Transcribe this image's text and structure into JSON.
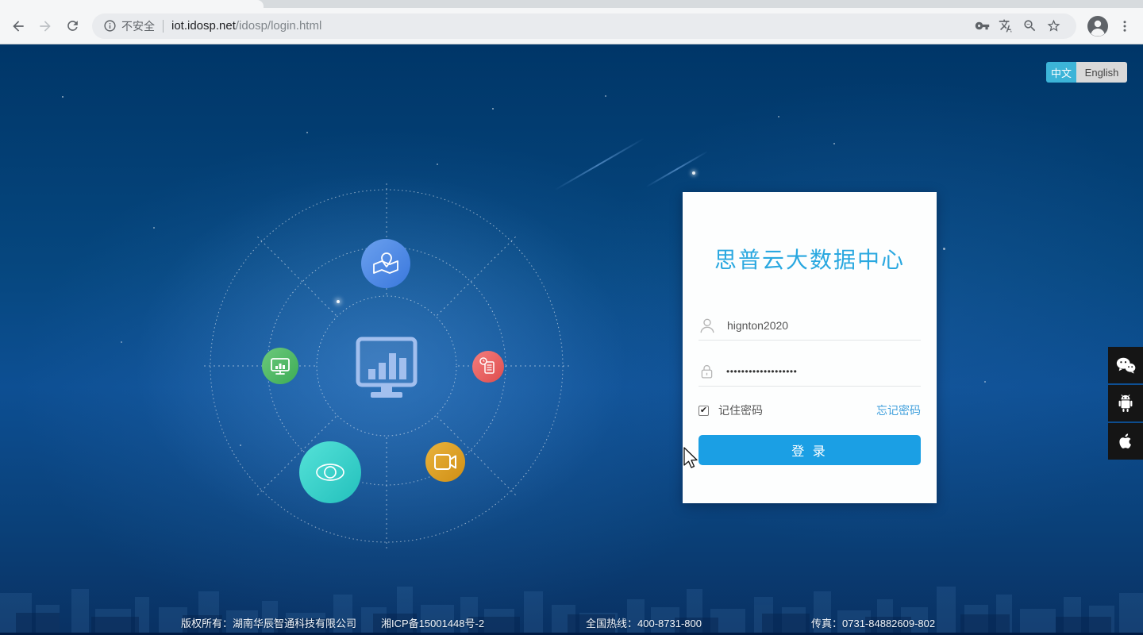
{
  "browser": {
    "security_label": "不安全",
    "url_host": "iot.idosp.net",
    "url_path": "/idosp/login.html"
  },
  "language_toggle": {
    "chinese": "中文",
    "english": "English"
  },
  "login": {
    "title": "思普云大数据中心",
    "username_value": "hignton2020",
    "password_value": "•••••••••••••••••••",
    "remember_label": "记住密码",
    "remember_checked_attr": "checked",
    "check_glyph": "✔",
    "forgot_label": "忘记密码",
    "submit_label": "登 录"
  },
  "footer": {
    "copyright": "版权所有：湖南华辰智通科技有限公司",
    "icp": "湘ICP备15001448号-2",
    "hotline": "全国热线：400-8731-800",
    "fax": "传真：0731-84882609-802"
  },
  "colors": {
    "accent_blue": "#1b9fe4",
    "title_blue": "#2aa8e0",
    "lang_active": "#3cb4d8",
    "page_navy": "#0a4078"
  },
  "icons": {
    "hero_center": "monitor-bar-chart-icon",
    "hero_top": "map-pin-icon",
    "hero_left": "mini-monitor-icon",
    "hero_right": "report-clock-icon",
    "hero_bottom_left": "eye-icon",
    "hero_bottom_right": "video-camera-icon",
    "social": [
      "wechat-icon",
      "android-icon",
      "apple-icon"
    ]
  }
}
